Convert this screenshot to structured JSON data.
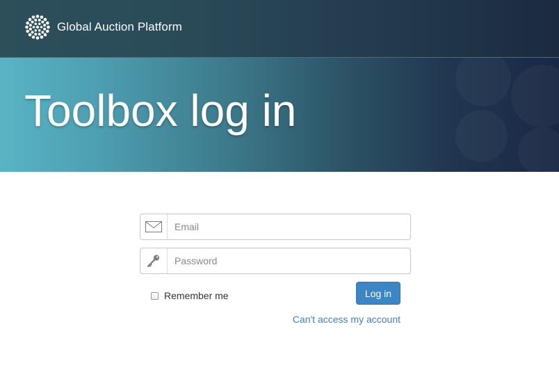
{
  "header": {
    "brand_name": "Global Auction Platform",
    "logo_icon": "dotted-circle-logo"
  },
  "hero": {
    "title": "Toolbox log in"
  },
  "login_form": {
    "email": {
      "placeholder": "Email",
      "value": "",
      "icon": "envelope-icon"
    },
    "password": {
      "placeholder": "Password",
      "value": "",
      "icon": "key-icon"
    },
    "remember_label": "Remember me",
    "remember_checked": false,
    "submit_label": "Log in",
    "help_link": "Can't access my account"
  },
  "colors": {
    "accent": "#3d86c6",
    "link": "#3d82c0",
    "header_bg": "#2a4a58",
    "hero_start": "#58b4c4",
    "hero_end": "#1a2845"
  }
}
